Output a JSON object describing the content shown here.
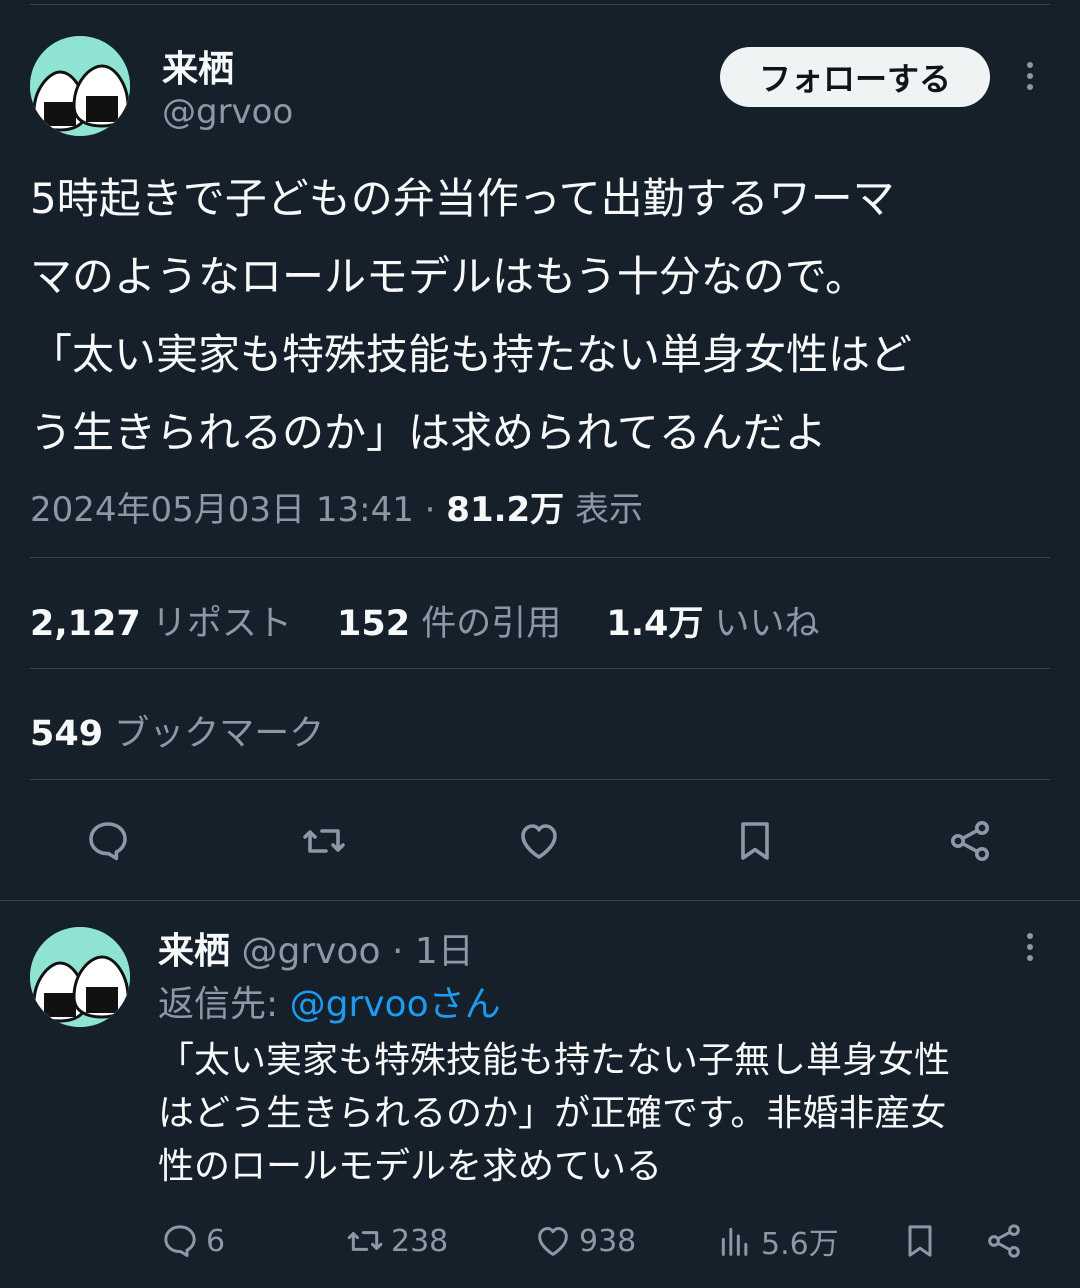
{
  "tweet": {
    "author_name": "来栖",
    "author_handle": "@grvoo",
    "follow_label": "フォローする",
    "text": "5時起きで子どもの弁当作って出勤するワーマ\nマのようなロールモデルはもう十分なので。\n「太い実家も特殊技能も持たない単身女性はど\nう生きられるのか」は求められてるんだよ",
    "timestamp": "2024年05月03日 13:41",
    "separator": "·",
    "views_count": "81.2万",
    "views_label": "表示",
    "stats": {
      "reposts_count": "2,127",
      "reposts_label": "リポスト",
      "quotes_count": "152",
      "quotes_label": "件の引用",
      "likes_count": "1.4万",
      "likes_label": "いいね",
      "bookmarks_count": "549",
      "bookmarks_label": "ブックマーク"
    }
  },
  "reply": {
    "author_name": "来栖",
    "author_handle": "@grvoo",
    "separator": "·",
    "time": "1日",
    "reply_to_label": "返信先:",
    "reply_to_mention": "@grvooさん",
    "text": "「太い実家も特殊技能も持たない子無し単身女性\nはどう生きられるのか」が正確です。非婚非産女\n性のロールモデルを求めている",
    "replies_count": "6",
    "reposts_count": "238",
    "likes_count": "938",
    "views_count": "5.6万"
  },
  "colors": {
    "background": "#15202b",
    "text": "#f7f9f9",
    "muted": "#8b98a5",
    "accent": "#1d9bf0",
    "divider": "#38444d",
    "avatar_bg": "#8ee3d3"
  },
  "icons": [
    "reply-icon",
    "repost-icon",
    "like-icon",
    "bookmark-icon",
    "share-icon",
    "views-icon",
    "more-icon"
  ]
}
